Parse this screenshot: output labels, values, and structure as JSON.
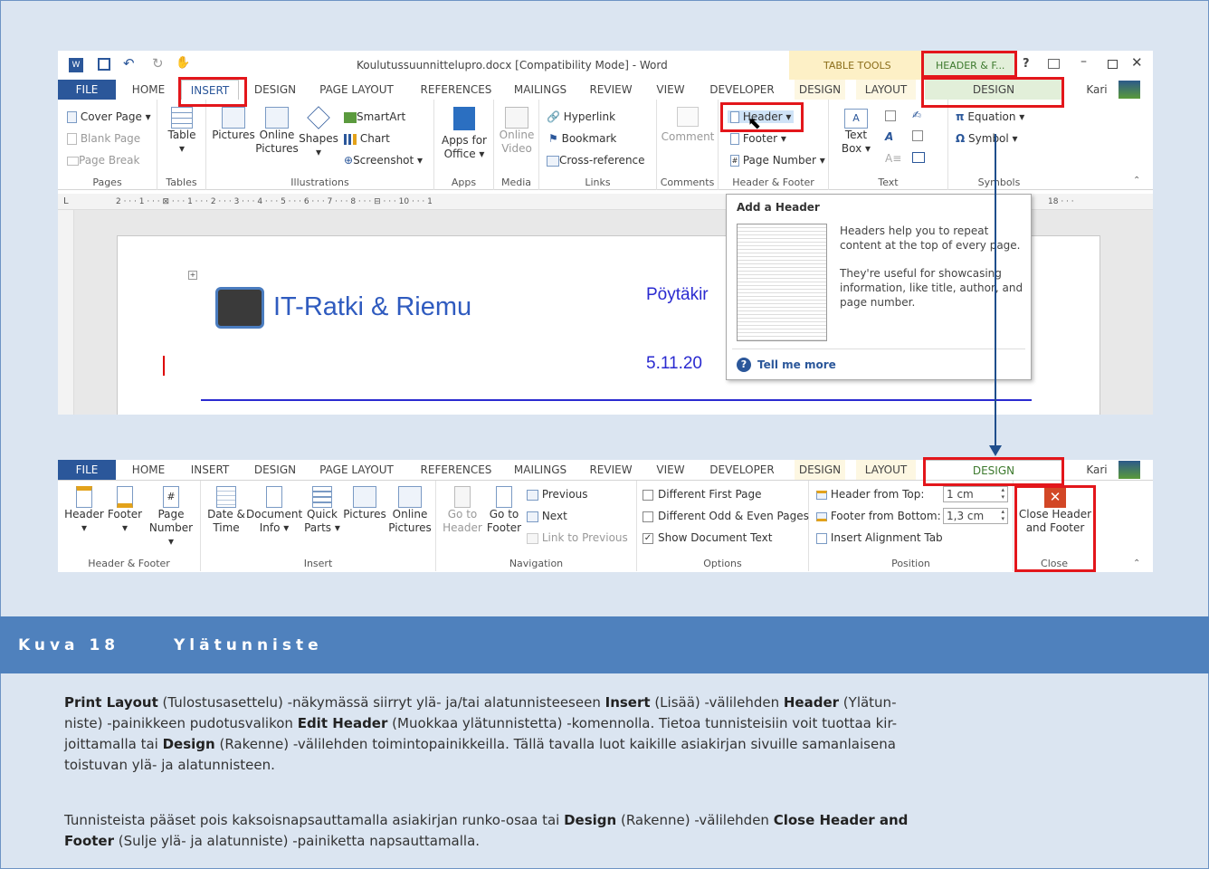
{
  "window": {
    "title": "Koulutussuunnittelupro.docx [Compatibility Mode] - Word",
    "table_tools": "TABLE TOOLS",
    "header_footer_tools": "HEADER & F...",
    "help": "?",
    "user": "Kari"
  },
  "tabs": {
    "file": "FILE",
    "home": "HOME",
    "insert": "INSERT",
    "design": "DESIGN",
    "page_layout": "PAGE LAYOUT",
    "references": "REFERENCES",
    "mailings": "MAILINGS",
    "review": "REVIEW",
    "view": "VIEW",
    "developer": "DEVELOPER",
    "tt_design": "DESIGN",
    "tt_layout": "LAYOUT",
    "hf_design": "DESIGN"
  },
  "insert_ribbon": {
    "pages": {
      "label": "Pages",
      "cover": "Cover Page",
      "blank": "Blank Page",
      "break": "Page Break"
    },
    "tables": {
      "label": "Tables",
      "table": "Table"
    },
    "illustrations": {
      "label": "Illustrations",
      "pictures": "Pictures",
      "online1": "Online",
      "online2": "Pictures",
      "shapes": "Shapes",
      "smartart": "SmartArt",
      "chart": "Chart",
      "screenshot": "Screenshot"
    },
    "apps": {
      "label": "Apps",
      "a1": "Apps for",
      "a2": "Office"
    },
    "media": {
      "label": "Media",
      "m1": "Online",
      "m2": "Video"
    },
    "links": {
      "label": "Links",
      "hyperlink": "Hyperlink",
      "bookmark": "Bookmark",
      "cross": "Cross-reference"
    },
    "comments": {
      "label": "Comments",
      "comment": "Comment"
    },
    "hf": {
      "label": "Header & Footer",
      "header": "Header",
      "footer": "Footer",
      "page_number": "Page Number"
    },
    "text": {
      "label": "Text",
      "t1": "Text",
      "t2": "Box"
    },
    "symbols": {
      "label": "Symbols",
      "equation": "Equation",
      "symbol": "Symbol"
    }
  },
  "ruler": {
    "marks": "2 · · · 1 · · · ⊠ · · · 1 · · · 2 · · · 3 · · · 4 · · · 5 · · · 6 · · · 7 · · · 8 · · · ⊟ · · · 10 · · · 1",
    "end": "18 · · ·"
  },
  "document": {
    "logo_text": "IT-Ratki & Riemu",
    "right_title": "Pöytäkir",
    "date": "5.11.20"
  },
  "popup": {
    "title": "Add a Header",
    "p1": "Headers help you to repeat content at the top of every page.",
    "p2": "They're useful for showcasing information, like title, author, and page number.",
    "tell_more": "Tell me more"
  },
  "design_ribbon": {
    "hf": {
      "label": "Header & Footer",
      "header": "Header",
      "footer": "Footer",
      "pn1": "Page",
      "pn2": "Number"
    },
    "insert": {
      "label": "Insert",
      "dt1": "Date &",
      "dt2": "Time",
      "doc1": "Document",
      "doc2": "Info",
      "qp1": "Quick",
      "qp2": "Parts",
      "pictures": "Pictures",
      "op1": "Online",
      "op2": "Pictures"
    },
    "navigation": {
      "label": "Navigation",
      "gh1": "Go to",
      "gh2": "Header",
      "gf1": "Go to",
      "gf2": "Footer",
      "previous": "Previous",
      "next": "Next",
      "link": "Link to Previous"
    },
    "options": {
      "label": "Options",
      "first": "Different First Page",
      "oddeven": "Different Odd & Even Pages",
      "show": "Show Document Text"
    },
    "position": {
      "label": "Position",
      "hft": "Header from Top:",
      "hft_val": "1 cm",
      "ffb": "Footer from Bottom:",
      "ffb_val": "1,3 cm",
      "align": "Insert Alignment Tab"
    },
    "close": {
      "label": "Close",
      "c1": "Close Header",
      "c2": "and Footer"
    }
  },
  "caption": {
    "number": "Kuva 18",
    "title": "Ylätunniste"
  },
  "body": {
    "p1_b1": "Print Layout",
    "p1_t1": " (Tulostusasettelu) -näkymässä siirryt ylä- ja/tai alatunnisteeseen ",
    "p1_b2": "Insert",
    "p1_t2": " (Lisää) -välilehden ",
    "p1_b3": "Header",
    "p1_t3": " (Ylätun-",
    "p1_l2a": "niste) -painikkeen pudotusvalikon ",
    "p1_b4": "Edit Header",
    "p1_l2b": " (Muokkaa ylätunnistetta) -komennolla. Tietoa tunnisteisiin voit tuottaa kir-",
    "p1_l3a": "joittamalla tai ",
    "p1_b5": "Design",
    "p1_l3b": " (Rakenne) -välilehden toimintopainikkeilla. Tällä tavalla luot kaikille asiakirjan sivuille samanlaisena",
    "p1_l4": "toistuvan ylä- ja alatunnisteen.",
    "p2_a": "Tunnisteista pääset pois kaksoisnapsauttamalla asiakirjan runko-osaa tai ",
    "p2_b1": "Design",
    "p2_b": " (Rakenne) -välilehden ",
    "p2_b2": "Close Header and",
    "p2_l2b": "Footer",
    "p2_l2": " (Sulje ylä- ja alatunniste) -painiketta napsauttamalla."
  }
}
